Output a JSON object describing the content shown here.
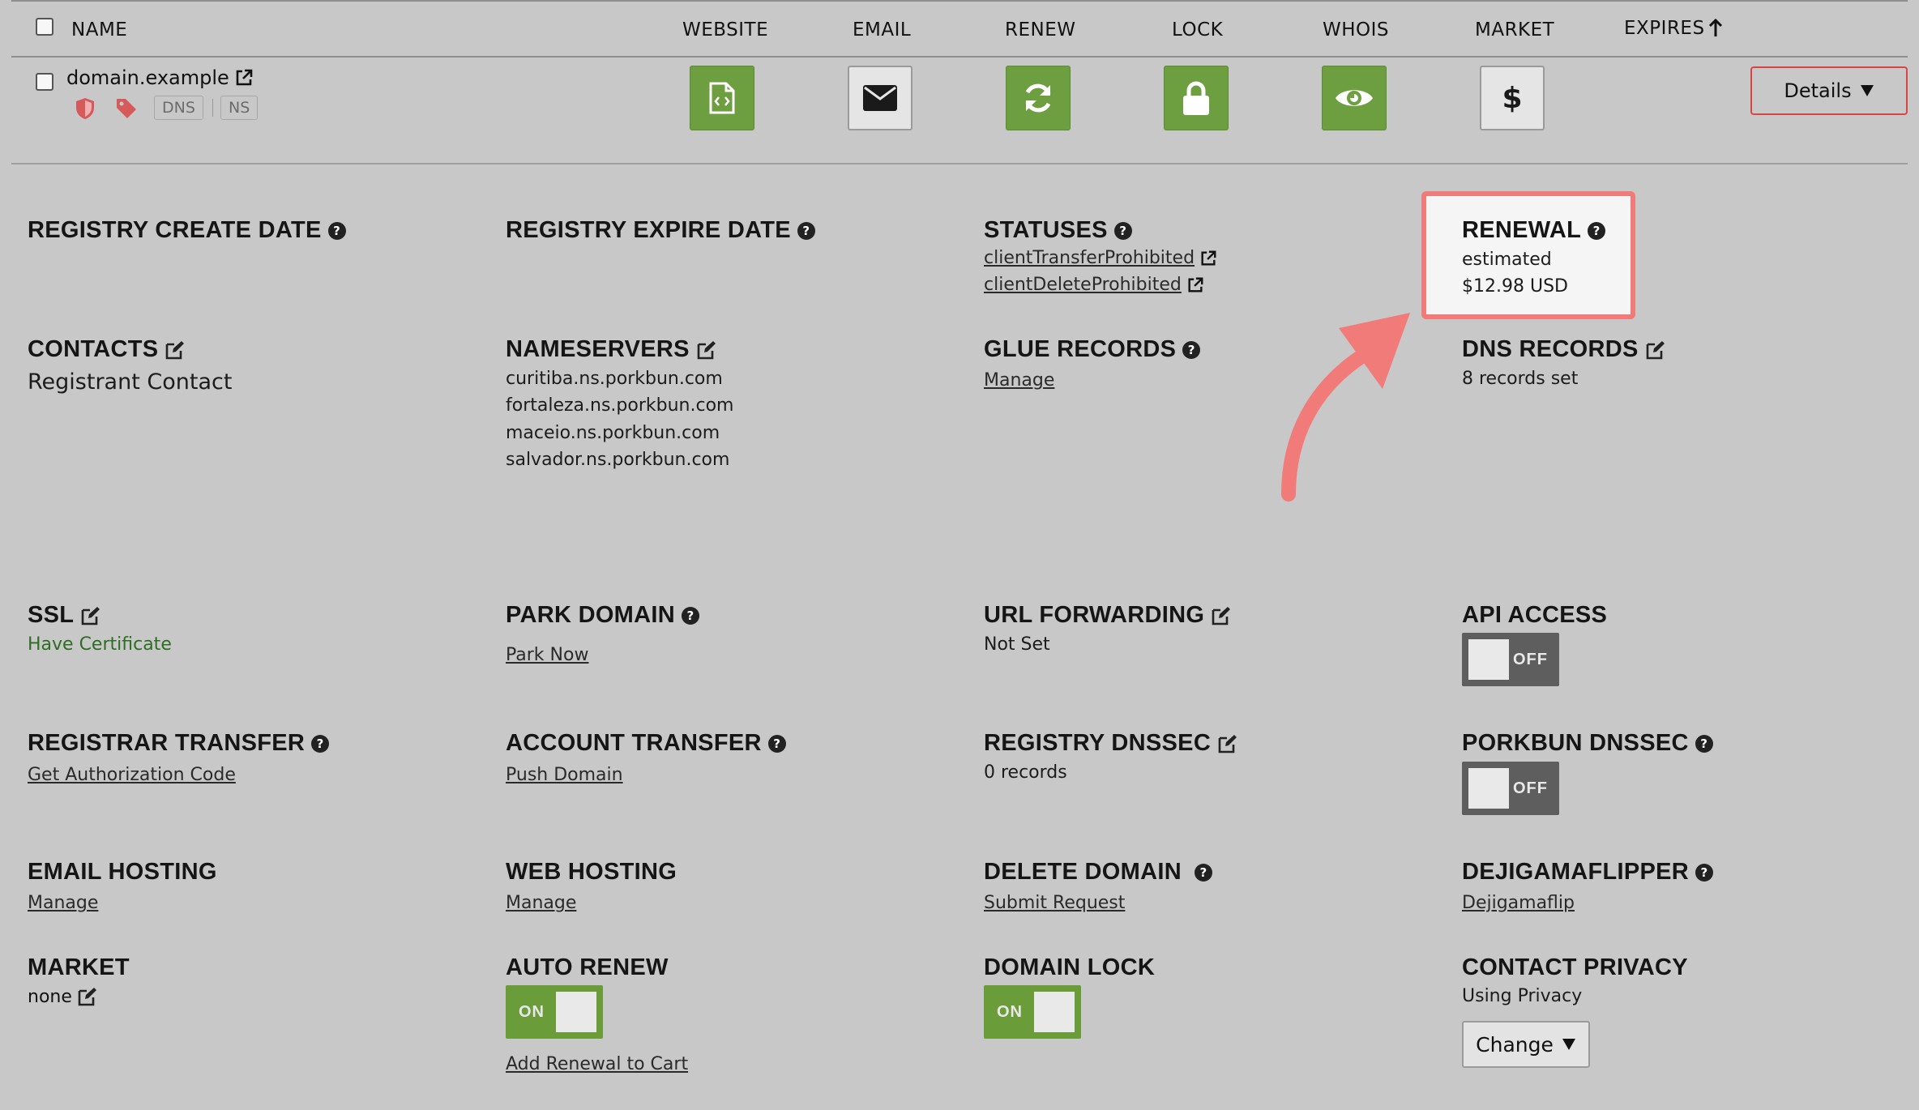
{
  "table": {
    "headers": {
      "name": "NAME",
      "website": "WEBSITE",
      "email": "EMAIL",
      "renew": "RENEW",
      "lock": "LOCK",
      "whois": "WHOIS",
      "market": "MARKET",
      "expires": "EXPIRES"
    },
    "row": {
      "domain": "domain.example",
      "tags": [
        "DNS",
        "NS"
      ],
      "market_icon": "$",
      "details_label": "Details"
    }
  },
  "sections": {
    "registry_create": {
      "title": "REGISTRY CREATE DATE"
    },
    "registry_expire": {
      "title": "REGISTRY EXPIRE DATE"
    },
    "statuses": {
      "title": "STATUSES",
      "items": [
        "clientTransferProhibited",
        "clientDeleteProhibited"
      ]
    },
    "renewal": {
      "title": "RENEWAL",
      "line1": "estimated",
      "line2": "$12.98 USD"
    },
    "contacts": {
      "title": "CONTACTS",
      "value": "Registrant Contact"
    },
    "nameservers": {
      "title": "NAMESERVERS",
      "items": [
        "curitiba.ns.porkbun.com",
        "fortaleza.ns.porkbun.com",
        "maceio.ns.porkbun.com",
        "salvador.ns.porkbun.com"
      ]
    },
    "glue_records": {
      "title": "GLUE RECORDS",
      "link": "Manage"
    },
    "dns_records": {
      "title": "DNS RECORDS",
      "value": "8 records set"
    },
    "ssl": {
      "title": "SSL",
      "value": "Have Certificate"
    },
    "park_domain": {
      "title": "PARK DOMAIN",
      "link": "Park Now"
    },
    "url_forwarding": {
      "title": "URL FORWARDING",
      "value": "Not Set"
    },
    "api_access": {
      "title": "API ACCESS",
      "toggle": "OFF"
    },
    "registrar_transfer": {
      "title": "REGISTRAR TRANSFER",
      "link": "Get Authorization Code"
    },
    "account_transfer": {
      "title": "ACCOUNT TRANSFER",
      "link": "Push Domain"
    },
    "registry_dnssec": {
      "title": "REGISTRY DNSSEC",
      "value": "0 records"
    },
    "porkbun_dnssec": {
      "title": "PORKBUN DNSSEC",
      "toggle": "OFF"
    },
    "email_hosting": {
      "title": "EMAIL HOSTING",
      "link": "Manage"
    },
    "web_hosting": {
      "title": "WEB HOSTING",
      "link": "Manage"
    },
    "delete_domain": {
      "title": "DELETE DOMAIN",
      "link": "Submit Request"
    },
    "dejigamaflipper": {
      "title": "DEJIGAMAFLIPPER",
      "link": "Dejigamaflip"
    },
    "market": {
      "title": "MARKET",
      "value": "none"
    },
    "auto_renew": {
      "title": "AUTO RENEW",
      "toggle": "ON",
      "link": "Add Renewal to Cart"
    },
    "domain_lock": {
      "title": "DOMAIN LOCK",
      "toggle": "ON"
    },
    "contact_privacy": {
      "title": "CONTACT PRIVACY",
      "value": "Using Privacy",
      "button": "Change"
    }
  },
  "colors": {
    "background": "#c8c8c8",
    "green": "#6d9e3f",
    "highlight": "#f07b78",
    "toggle_off": "#5e5e5e"
  }
}
